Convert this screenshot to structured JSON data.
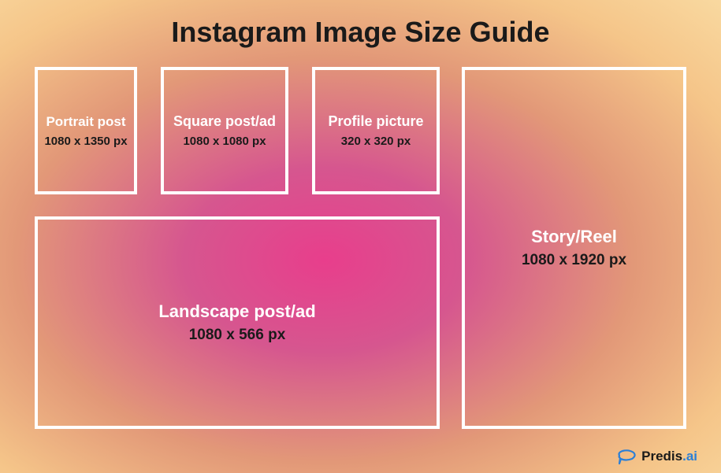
{
  "title": "Instagram Image Size Guide",
  "boxes": {
    "portrait": {
      "label": "Portrait post",
      "dim": "1080 x 1350 px"
    },
    "square": {
      "label": "Square post/ad",
      "dim": "1080 x 1080 px"
    },
    "profile": {
      "label": "Profile picture",
      "dim": "320 x 320 px"
    },
    "landscape": {
      "label": "Landscape post/ad",
      "dim": "1080 x 566 px"
    },
    "story": {
      "label": "Story/Reel",
      "dim": "1080 x 1920 px"
    }
  },
  "brand": {
    "name_dark": "Predis",
    "name_blue": ".ai"
  }
}
